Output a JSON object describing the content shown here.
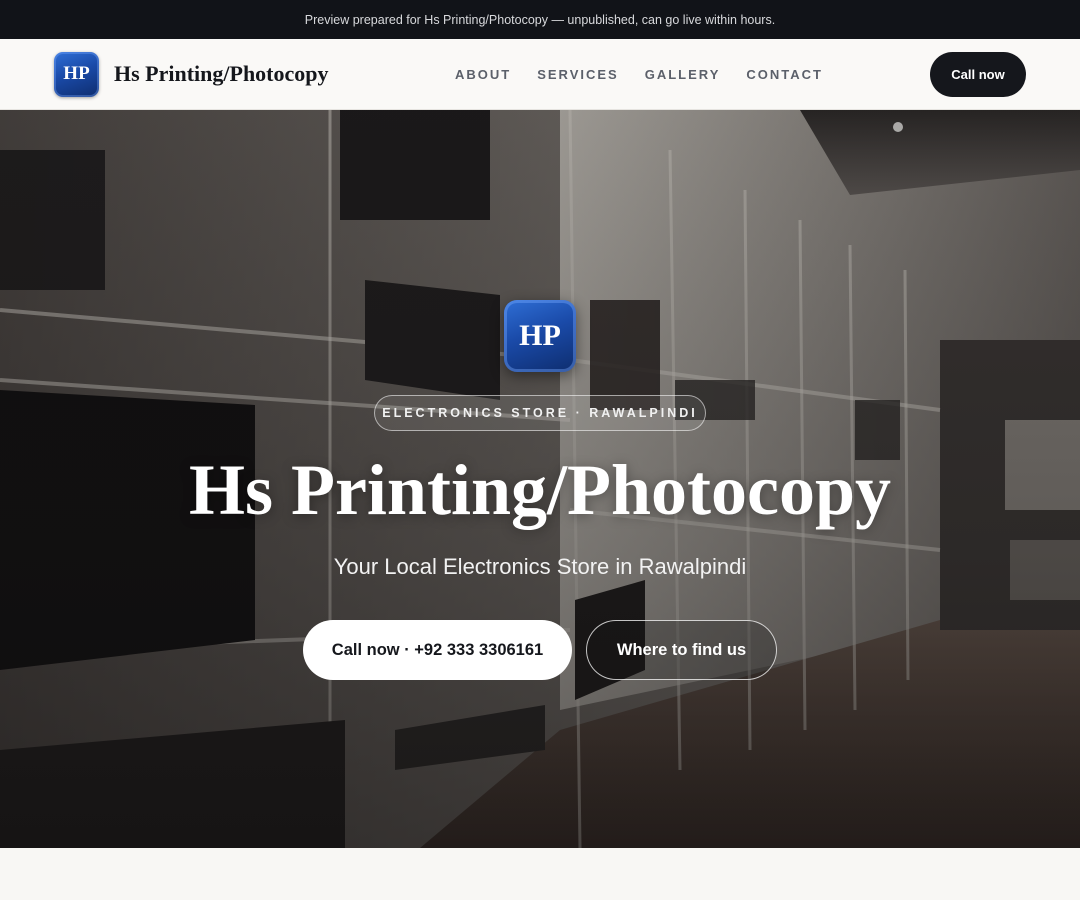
{
  "preview_banner": {
    "text": "Preview prepared for Hs Printing/Photocopy — unpublished, can go live within hours."
  },
  "header": {
    "logo_text": "HP",
    "brand_name": "Hs Printing/Photocopy",
    "nav": [
      {
        "label": "ABOUT"
      },
      {
        "label": "SERVICES"
      },
      {
        "label": "GALLERY"
      },
      {
        "label": "CONTACT"
      }
    ],
    "cta_label": "Call now"
  },
  "hero": {
    "logo_text": "HP",
    "eyebrow": "ELECTRONICS STORE · RAWALPINDI",
    "title": "Hs Printing/Photocopy",
    "subtitle": "Your Local Electronics Store in Rawalpindi",
    "primary_button": "Call now · +92 333 3306161",
    "secondary_button": "Where to find us",
    "background_image": "electronics-store-interior-with-tv-shelves"
  },
  "colors": {
    "dark": "#15171c",
    "banner_bg": "#111318",
    "logo_blue": "#1a4aa8",
    "page_bg": "#f8f7f4"
  }
}
